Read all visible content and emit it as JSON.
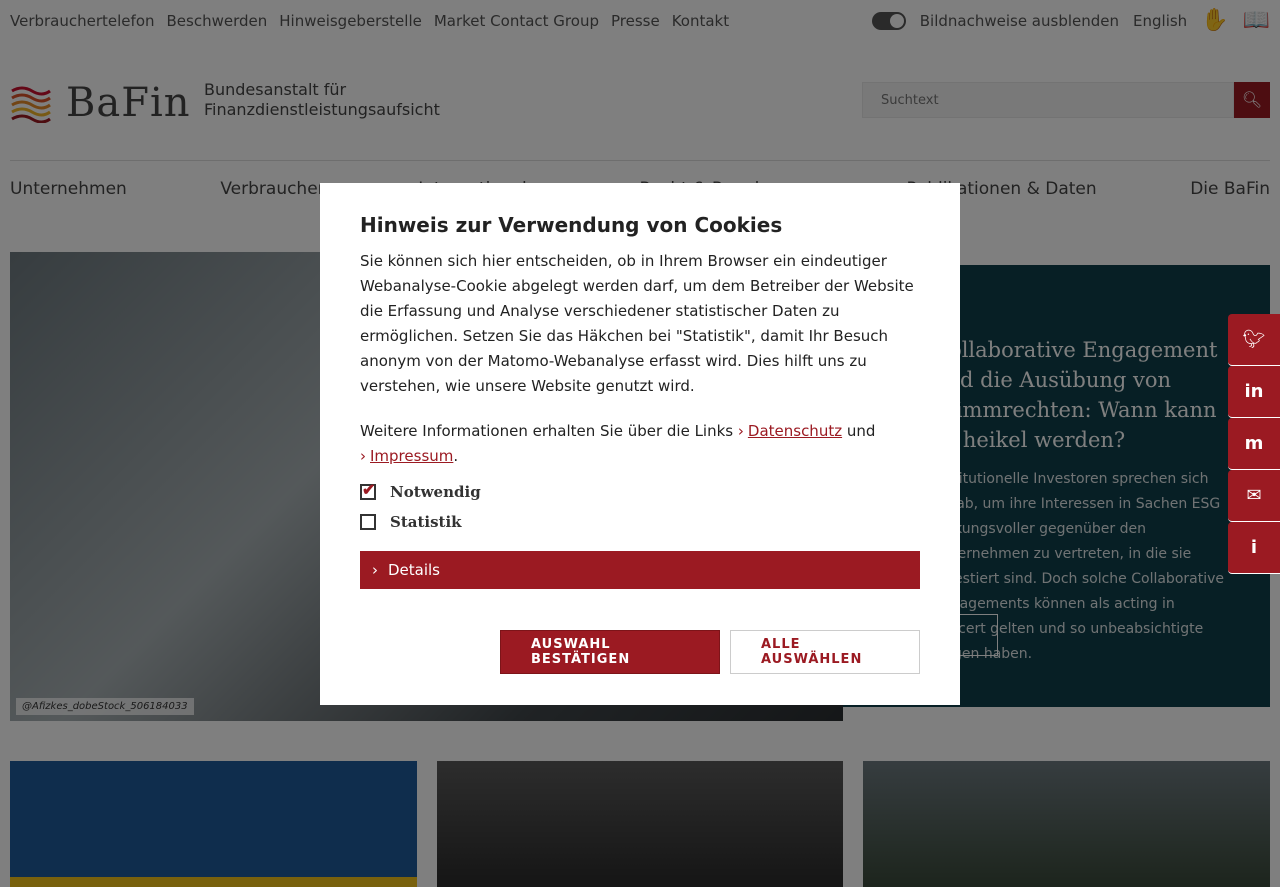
{
  "topbar": {
    "links": [
      "Verbrauchertelefon",
      "Beschwerden",
      "Hinweisgeberstelle",
      "Market Contact Group",
      "Presse",
      "Kontakt"
    ],
    "image_toggle_label": "Bildnachweise ausblenden",
    "language": "English"
  },
  "header": {
    "logo_word": "BaFin",
    "subtitle_line1": "Bundesanstalt für",
    "subtitle_line2": "Finanzdienstleistungsaufsicht",
    "search_placeholder": "Suchtext"
  },
  "mainnav": [
    "Unternehmen",
    "Verbraucher",
    "Internationales",
    "Recht & Regelungen",
    "Publikationen & Daten",
    "Die BaFin"
  ],
  "hero": {
    "credit": "@Afizkes_dobeStock_506184033"
  },
  "teaser": {
    "title": "Collaborative Engagement und die Ausübung von Stimmrechten: Wann kann es heikel werden?",
    "text": "Institutionelle Investoren sprechen sich oft ab, um ihre Interessen in Sachen ESG wirkungsvoller gegenüber den Unternehmen zu vertreten, in die sie investiert sind. Doch solche Collaborative Engagements können als acting in concert gelten und so unbeabsichtigte Folgen haben."
  },
  "social": [
    "twitter-icon",
    "linkedin-icon",
    "mastodon-icon",
    "mail-icon",
    "info-icon"
  ],
  "cookie_modal": {
    "title": "Hinweis zur Verwendung von Cookies",
    "intro": "Sie können sich hier entscheiden, ob in Ihrem Browser ein eindeutiger Webanalyse-Cookie abgelegt werden darf, um dem Betreiber der Website die Erfassung und Analyse verschiedener statistischer Daten zu ermöglichen. Setzen Sie das Häkchen bei \"Statistik\", damit Ihr Besuch anonym von der Matomo-Webanalyse erfasst wird. Dies hilft uns zu verstehen, wie unsere Website genutzt wird.",
    "links_prefix": "Weitere Informationen erhalten Sie über die Links",
    "link_privacy": "Datenschutz",
    "links_and": "und",
    "link_imprint": "Impressum",
    "links_end": ".",
    "check_necessary": "Notwendig",
    "check_statistics": "Statistik",
    "details_label": "Details",
    "confirm_button": "AUSWAHL BESTÄTIGEN",
    "select_all_button": "ALLE AUSWÄHLEN"
  },
  "colors": {
    "brand_red": "#9b1a22",
    "teaser_bg": "#0e3f4a"
  }
}
